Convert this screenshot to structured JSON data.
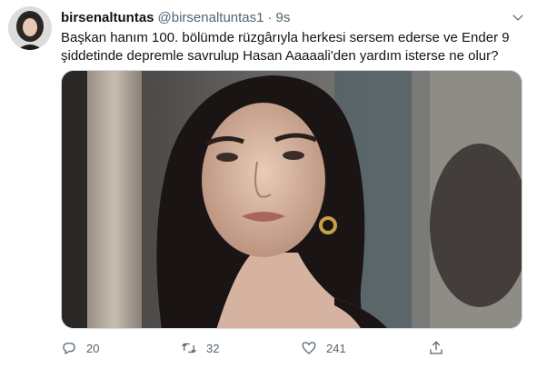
{
  "tweet": {
    "display_name": "birsenaltuntas",
    "handle": "@birsenaltuntas1",
    "separator": "·",
    "time": "9s",
    "text_lines": [
      "Başkan hanım 100. bölümde rüzgârıyla herkesi sersem ederse ve  Ender 9",
      "şiddetinde depremle savrulup Hasan Aaaaali'den yardım isterse ne olur?"
    ]
  },
  "actions": {
    "reply_count": "20",
    "retweet_count": "32",
    "like_count": "241"
  },
  "icons": {
    "reply": "reply-icon",
    "retweet": "retweet-icon",
    "like": "heart-icon",
    "share": "share-icon",
    "more": "chevron-down-icon"
  },
  "colors": {
    "text_primary": "#0f1419",
    "text_secondary": "#536471",
    "border": "#cfd9de"
  }
}
